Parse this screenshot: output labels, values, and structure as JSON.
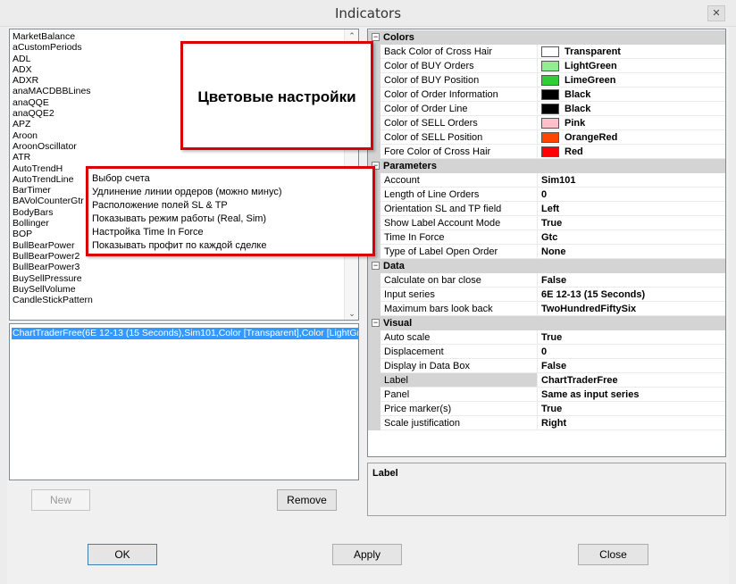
{
  "window": {
    "title": "Indicators"
  },
  "indicator_list": [
    " MarketBalance",
    "aCustomPeriods",
    "ADL",
    "ADX",
    "ADXR",
    "anaMACDBBLines",
    "anaQQE",
    "anaQQE2",
    "APZ",
    "Aroon",
    "AroonOscillator",
    "ATR",
    "AutoTrendH",
    "AutoTrendLine",
    "BarTimer",
    "BAVolCounterGtr",
    "BodyBars",
    "Bollinger",
    "BOP",
    "BullBearPower",
    "BullBearPower2",
    "BullBearPower3",
    "BuySellPressure",
    "BuySellVolume",
    "CandleStickPattern"
  ],
  "selected_indicator": "ChartTraderFree(6E 12-13 (15 Seconds),Sim101,Color [Transparent],Color [LightGr",
  "buttons": {
    "new": "New",
    "remove": "Remove",
    "ok": "OK",
    "apply": "Apply",
    "close": "Close"
  },
  "property_grid": {
    "categories": [
      {
        "name": "Colors",
        "rows": [
          {
            "name": "Back Color of Cross Hair",
            "value": "Transparent",
            "swatch": "#ffffff"
          },
          {
            "name": "Color of BUY Orders",
            "value": "LightGreen",
            "swatch": "#90ee90"
          },
          {
            "name": "Color of BUY Position",
            "value": "LimeGreen",
            "swatch": "#32cd32"
          },
          {
            "name": "Color of Order Information",
            "value": "Black",
            "swatch": "#000000"
          },
          {
            "name": "Color of Order Line",
            "value": "Black",
            "swatch": "#000000"
          },
          {
            "name": "Color of SELL Orders",
            "value": "Pink",
            "swatch": "#ffc0cb"
          },
          {
            "name": "Color of SELL Position",
            "value": "OrangeRed",
            "swatch": "#ff4500"
          },
          {
            "name": "Fore Color of Cross Hair",
            "value": "Red",
            "swatch": "#ff0000"
          }
        ]
      },
      {
        "name": "Parameters",
        "rows": [
          {
            "name": "Account",
            "value": "Sim101"
          },
          {
            "name": "Length of Line Orders",
            "value": "0"
          },
          {
            "name": "Orientation SL and TP field",
            "value": "Left"
          },
          {
            "name": "Show Label Account Mode",
            "value": "True"
          },
          {
            "name": "Time In Force",
            "value": "Gtc"
          },
          {
            "name": "Type of Label Open Order",
            "value": "None"
          }
        ]
      },
      {
        "name": "Data",
        "rows": [
          {
            "name": "Calculate on bar close",
            "value": "False"
          },
          {
            "name": "Input series",
            "value": "6E 12-13 (15 Seconds)"
          },
          {
            "name": "Maximum bars look back",
            "value": "TwoHundredFiftySix"
          }
        ]
      },
      {
        "name": "Visual",
        "rows": [
          {
            "name": "Auto scale",
            "value": "True"
          },
          {
            "name": "Displacement",
            "value": "0"
          },
          {
            "name": "Display in Data Box",
            "value": "False"
          },
          {
            "name": "Label",
            "value": "ChartTraderFree",
            "selected": true
          },
          {
            "name": "Panel",
            "value": "Same as input series"
          },
          {
            "name": "Price marker(s)",
            "value": "True"
          },
          {
            "name": "Scale justification",
            "value": "Right"
          }
        ]
      }
    ]
  },
  "description": {
    "title": "Label"
  },
  "annotations": {
    "colors_note": "Цветовые настройки",
    "params_notes": [
      "Выбор счета",
      "Удлинение линии ордеров (можно минус)",
      "Расположение полей SL & TP",
      "Показывать режим работы (Real, Sim)",
      "Настройка Time In Force",
      "Показывать профит  по каждой сделке"
    ]
  },
  "colors": {
    "annotation_border": "#d80000",
    "selection": "#3399ff"
  }
}
